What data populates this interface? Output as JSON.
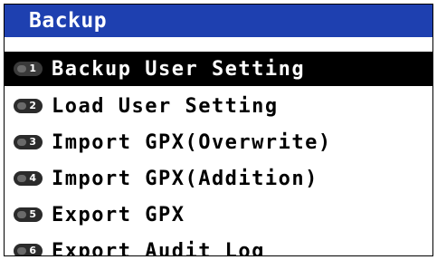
{
  "title": "Backup",
  "colors": {
    "title_bar": "#1e40b0",
    "selected_bg": "#000000",
    "selected_text": "#ffffff",
    "text": "#000000",
    "badge": "#2b2b2b"
  },
  "menu": {
    "selected_index": 0,
    "items": [
      {
        "number": "1",
        "label": "Backup User Setting"
      },
      {
        "number": "2",
        "label": "Load User Setting"
      },
      {
        "number": "3",
        "label": "Import GPX(Overwrite)"
      },
      {
        "number": "4",
        "label": "Import GPX(Addition)"
      },
      {
        "number": "5",
        "label": "Export GPX"
      },
      {
        "number": "6",
        "label": "Export Audit Log"
      }
    ]
  }
}
